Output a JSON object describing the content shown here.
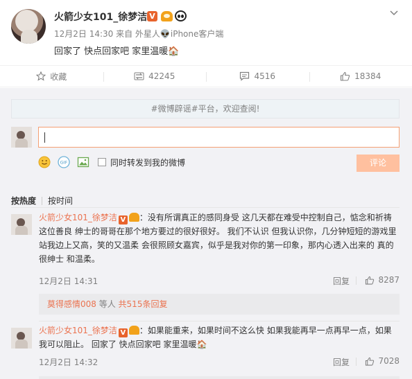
{
  "post": {
    "author": "火箭少女101_徐梦洁",
    "verified_badge": "V",
    "meta": "12月2日 14:30 来自 外星人👽iPhone客户端",
    "text": "回家了 快点回家吧 家里温暖🏠"
  },
  "actions": {
    "favorite": "收藏",
    "repost": "42245",
    "comment": "4516",
    "like": "18384"
  },
  "notice": {
    "hashtag": "#微博辟谣#",
    "rest": "平台，欢迎查阅!"
  },
  "composer": {
    "input_value": "",
    "repost_checkbox_label": "同时转发到我的微博",
    "submit_label": "评论"
  },
  "sort": {
    "hot": "按热度",
    "time": "按时间"
  },
  "comments": [
    {
      "user": "火箭少女101_徐梦洁",
      "verified_badge": "V",
      "text": "：没有所谓真正的感同身受 这几天都在难受中控制自己，惦念和祈祷这位善良 绅士的哥哥在那个地方要过的很好很好。 我们不认识 但我认识你，几分钟短短的游戏里站我边上又高，笑的又温柔 会很照顾女嘉宾，似乎是我对你的第一印象，那内心透入出来的 真的很绅士 和温柔。",
      "time": "12月2日 14:31",
      "reply": "回复",
      "likes": "8287",
      "sub_user": "莫得感情008",
      "sub_mid": " 等人 ",
      "sub_link": "共515条回复"
    },
    {
      "user": "火箭少女101_徐梦洁",
      "verified_badge": "V",
      "text": "：如果能重来，如果时间不这么快 如果我能再早一点再早一点，如果我可以阻止。 回家了 快点回家吧 家里温暖🏠",
      "time": "12月2日 14:32",
      "reply": "回复",
      "likes": "7028"
    }
  ],
  "colors": {
    "accent": "#eb7350",
    "muted": "#808080",
    "panel": "#f2f2f5",
    "submit": "#ffc09f"
  }
}
